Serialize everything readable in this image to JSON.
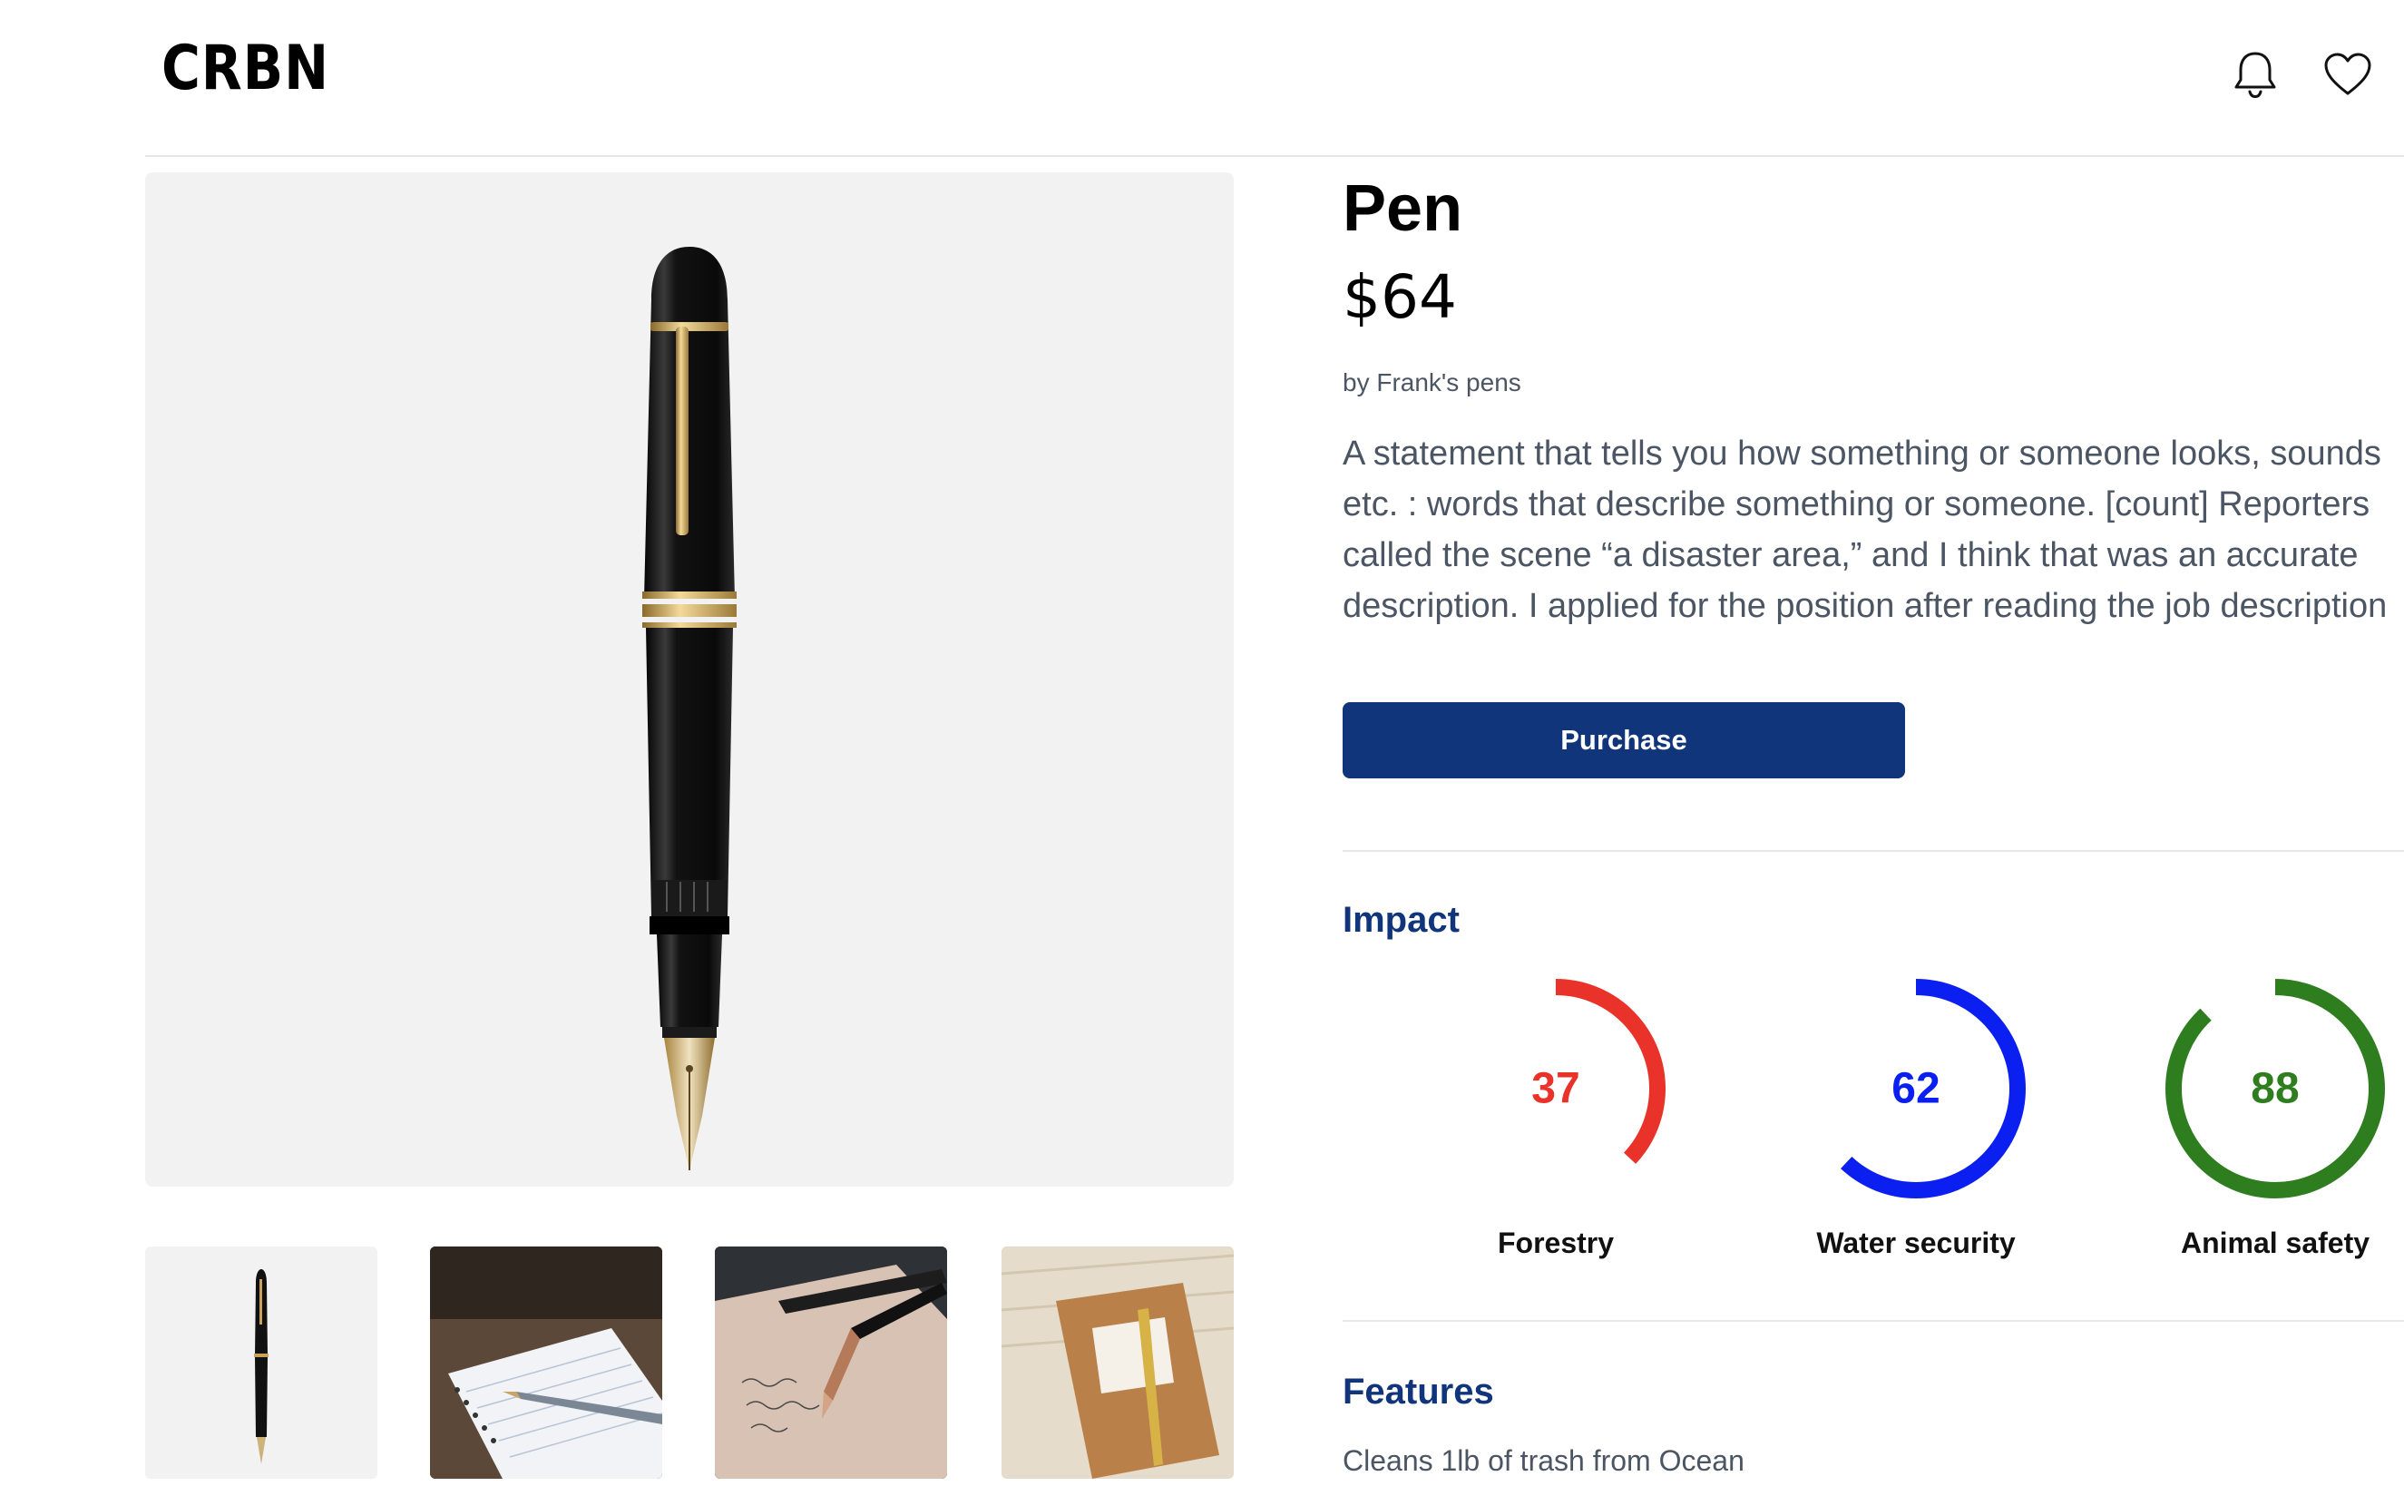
{
  "header": {
    "logo": "CRBN",
    "icons": [
      "bell-icon",
      "heart-icon"
    ]
  },
  "product": {
    "title": "Pen",
    "price": "$64",
    "seller": "by Frank's pens",
    "description_lines": [
      "A statement that tells you how something or someone looks, sounds",
      "etc. : words that describe something or someone. [count] Reporters",
      "called the scene “a disaster area,” and I think that was an accurate",
      "description. I applied for the position after reading the job description"
    ],
    "purchase_label": "Purchase"
  },
  "gallery": {
    "thumbnails": [
      "pen-product-thumbnail",
      "pen-on-notebook-photo",
      "pen-on-letter-photo",
      "gold-pen-on-leather-notebook-photo"
    ]
  },
  "impact": {
    "title": "Impact",
    "metrics": [
      {
        "label": "Forestry",
        "value": 37,
        "max": 100,
        "color": "#e8322a"
      },
      {
        "label": "Water security",
        "value": 62,
        "max": 100,
        "color": "#0a1ff0"
      },
      {
        "label": "Animal safety",
        "value": 88,
        "max": 100,
        "color": "#2e7d1f"
      }
    ]
  },
  "features": {
    "title": "Features",
    "items": [
      "Cleans 1lb of trash from Ocean"
    ]
  },
  "colors": {
    "primary": "#11357a",
    "muted_text": "#4b5563",
    "image_bg": "#f2f2f2"
  }
}
